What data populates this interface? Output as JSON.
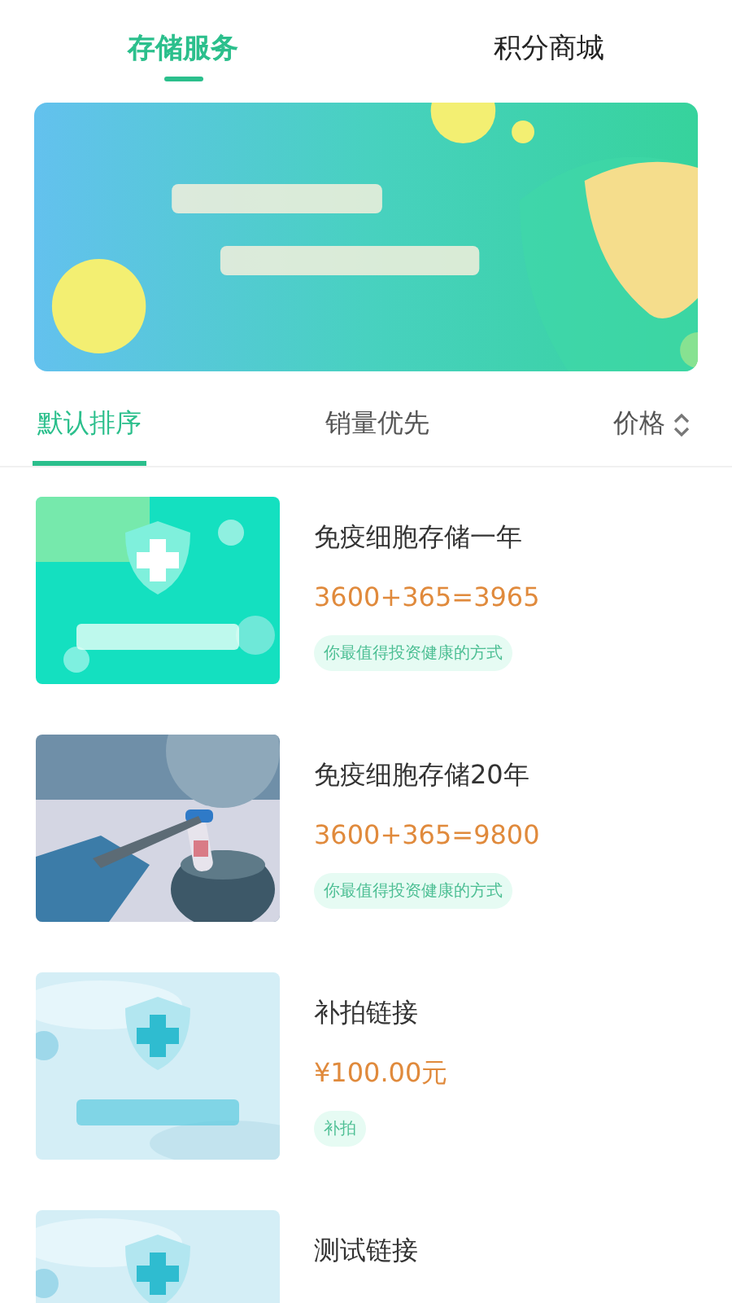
{
  "tabs": [
    {
      "label": "存储服务",
      "selected": true
    },
    {
      "label": "积分商城",
      "selected": false
    }
  ],
  "sort_options": [
    {
      "label": "默认排序",
      "selected": true,
      "kind": "plain"
    },
    {
      "label": "销量优先",
      "selected": false,
      "kind": "plain"
    },
    {
      "label": "价格",
      "selected": false,
      "kind": "toggle"
    }
  ],
  "products": [
    {
      "title": "免疫细胞存储一年",
      "price": "3600+365=3965",
      "tag": "你最值得投资健康的方式",
      "kind": "green"
    },
    {
      "title": "免疫细胞存储20年",
      "price": "3600+365=9800",
      "tag": "你最值得投资健康的方式",
      "kind": "lab"
    },
    {
      "title": "补拍链接",
      "price": "¥100.00元",
      "tag": "补拍",
      "kind": "light"
    },
    {
      "title": "测试链接",
      "kind": "light"
    }
  ]
}
